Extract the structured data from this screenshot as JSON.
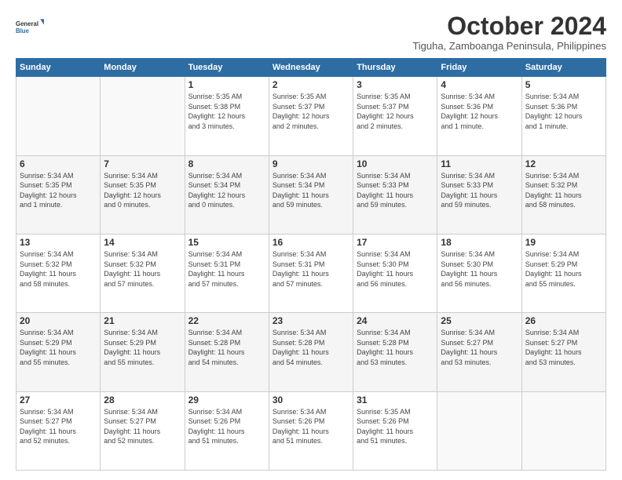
{
  "logo": {
    "general": "General",
    "blue": "Blue"
  },
  "header": {
    "month": "October 2024",
    "location": "Tiguha, Zamboanga Peninsula, Philippines"
  },
  "days_of_week": [
    "Sunday",
    "Monday",
    "Tuesday",
    "Wednesday",
    "Thursday",
    "Friday",
    "Saturday"
  ],
  "weeks": [
    [
      {
        "day": "",
        "info": ""
      },
      {
        "day": "",
        "info": ""
      },
      {
        "day": "1",
        "info": "Sunrise: 5:35 AM\nSunset: 5:38 PM\nDaylight: 12 hours\nand 3 minutes."
      },
      {
        "day": "2",
        "info": "Sunrise: 5:35 AM\nSunset: 5:37 PM\nDaylight: 12 hours\nand 2 minutes."
      },
      {
        "day": "3",
        "info": "Sunrise: 5:35 AM\nSunset: 5:37 PM\nDaylight: 12 hours\nand 2 minutes."
      },
      {
        "day": "4",
        "info": "Sunrise: 5:34 AM\nSunset: 5:36 PM\nDaylight: 12 hours\nand 1 minute."
      },
      {
        "day": "5",
        "info": "Sunrise: 5:34 AM\nSunset: 5:36 PM\nDaylight: 12 hours\nand 1 minute."
      }
    ],
    [
      {
        "day": "6",
        "info": "Sunrise: 5:34 AM\nSunset: 5:35 PM\nDaylight: 12 hours\nand 1 minute."
      },
      {
        "day": "7",
        "info": "Sunrise: 5:34 AM\nSunset: 5:35 PM\nDaylight: 12 hours\nand 0 minutes."
      },
      {
        "day": "8",
        "info": "Sunrise: 5:34 AM\nSunset: 5:34 PM\nDaylight: 12 hours\nand 0 minutes."
      },
      {
        "day": "9",
        "info": "Sunrise: 5:34 AM\nSunset: 5:34 PM\nDaylight: 11 hours\nand 59 minutes."
      },
      {
        "day": "10",
        "info": "Sunrise: 5:34 AM\nSunset: 5:33 PM\nDaylight: 11 hours\nand 59 minutes."
      },
      {
        "day": "11",
        "info": "Sunrise: 5:34 AM\nSunset: 5:33 PM\nDaylight: 11 hours\nand 59 minutes."
      },
      {
        "day": "12",
        "info": "Sunrise: 5:34 AM\nSunset: 5:32 PM\nDaylight: 11 hours\nand 58 minutes."
      }
    ],
    [
      {
        "day": "13",
        "info": "Sunrise: 5:34 AM\nSunset: 5:32 PM\nDaylight: 11 hours\nand 58 minutes."
      },
      {
        "day": "14",
        "info": "Sunrise: 5:34 AM\nSunset: 5:32 PM\nDaylight: 11 hours\nand 57 minutes."
      },
      {
        "day": "15",
        "info": "Sunrise: 5:34 AM\nSunset: 5:31 PM\nDaylight: 11 hours\nand 57 minutes."
      },
      {
        "day": "16",
        "info": "Sunrise: 5:34 AM\nSunset: 5:31 PM\nDaylight: 11 hours\nand 57 minutes."
      },
      {
        "day": "17",
        "info": "Sunrise: 5:34 AM\nSunset: 5:30 PM\nDaylight: 11 hours\nand 56 minutes."
      },
      {
        "day": "18",
        "info": "Sunrise: 5:34 AM\nSunset: 5:30 PM\nDaylight: 11 hours\nand 56 minutes."
      },
      {
        "day": "19",
        "info": "Sunrise: 5:34 AM\nSunset: 5:29 PM\nDaylight: 11 hours\nand 55 minutes."
      }
    ],
    [
      {
        "day": "20",
        "info": "Sunrise: 5:34 AM\nSunset: 5:29 PM\nDaylight: 11 hours\nand 55 minutes."
      },
      {
        "day": "21",
        "info": "Sunrise: 5:34 AM\nSunset: 5:29 PM\nDaylight: 11 hours\nand 55 minutes."
      },
      {
        "day": "22",
        "info": "Sunrise: 5:34 AM\nSunset: 5:28 PM\nDaylight: 11 hours\nand 54 minutes."
      },
      {
        "day": "23",
        "info": "Sunrise: 5:34 AM\nSunset: 5:28 PM\nDaylight: 11 hours\nand 54 minutes."
      },
      {
        "day": "24",
        "info": "Sunrise: 5:34 AM\nSunset: 5:28 PM\nDaylight: 11 hours\nand 53 minutes."
      },
      {
        "day": "25",
        "info": "Sunrise: 5:34 AM\nSunset: 5:27 PM\nDaylight: 11 hours\nand 53 minutes."
      },
      {
        "day": "26",
        "info": "Sunrise: 5:34 AM\nSunset: 5:27 PM\nDaylight: 11 hours\nand 53 minutes."
      }
    ],
    [
      {
        "day": "27",
        "info": "Sunrise: 5:34 AM\nSunset: 5:27 PM\nDaylight: 11 hours\nand 52 minutes."
      },
      {
        "day": "28",
        "info": "Sunrise: 5:34 AM\nSunset: 5:27 PM\nDaylight: 11 hours\nand 52 minutes."
      },
      {
        "day": "29",
        "info": "Sunrise: 5:34 AM\nSunset: 5:26 PM\nDaylight: 11 hours\nand 51 minutes."
      },
      {
        "day": "30",
        "info": "Sunrise: 5:34 AM\nSunset: 5:26 PM\nDaylight: 11 hours\nand 51 minutes."
      },
      {
        "day": "31",
        "info": "Sunrise: 5:35 AM\nSunset: 5:26 PM\nDaylight: 11 hours\nand 51 minutes."
      },
      {
        "day": "",
        "info": ""
      },
      {
        "day": "",
        "info": ""
      }
    ]
  ]
}
